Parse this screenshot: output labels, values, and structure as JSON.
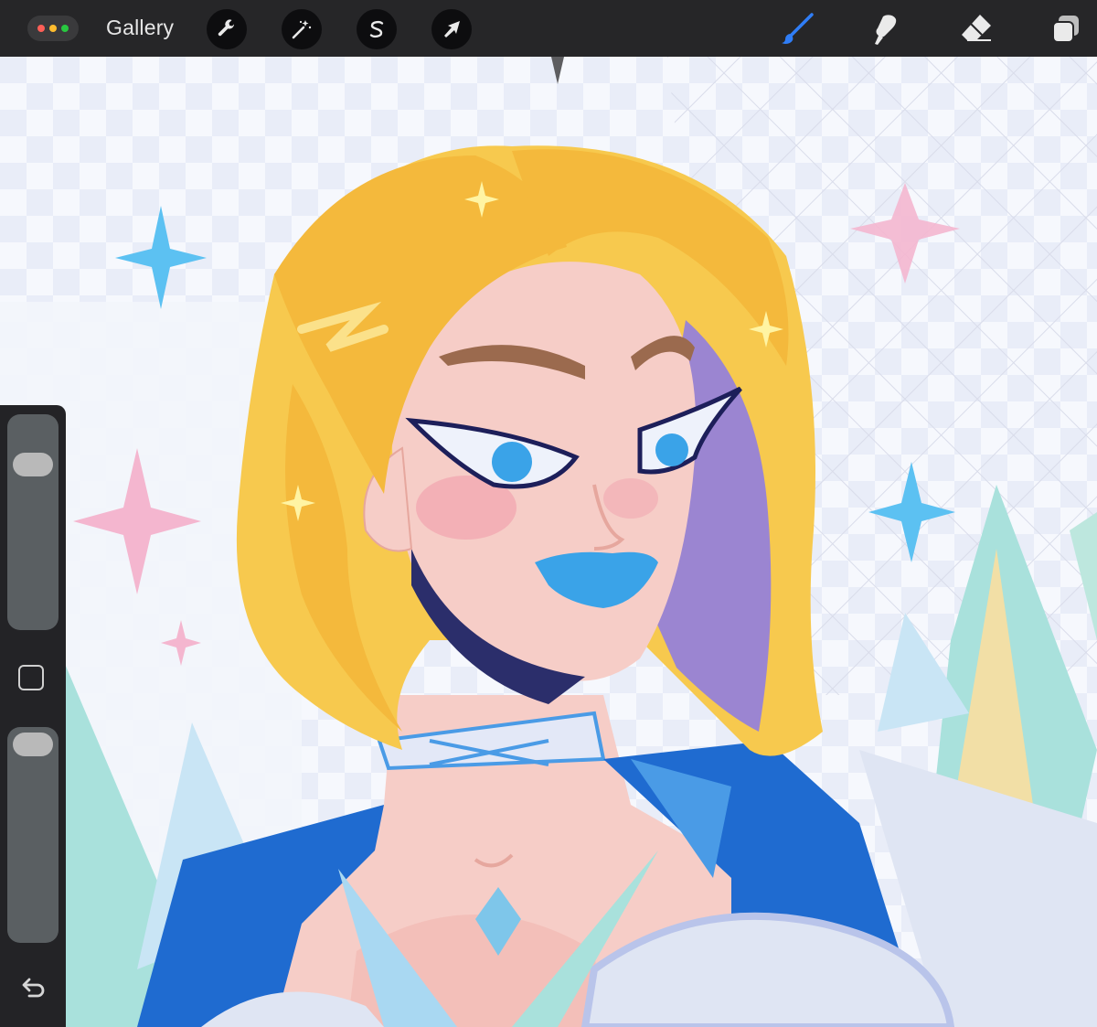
{
  "app": {
    "gallery_label": "Gallery"
  },
  "toolbar": {
    "left_tools": [
      {
        "name": "actions",
        "icon": "wrench-icon"
      },
      {
        "name": "adjustments",
        "icon": "magic-wand-icon"
      },
      {
        "name": "selection",
        "icon": "selection-s-icon"
      },
      {
        "name": "transform",
        "icon": "arrow-cursor-icon"
      }
    ],
    "right_tools": [
      {
        "name": "brush",
        "icon": "brush-icon",
        "active": true
      },
      {
        "name": "smudge",
        "icon": "smudge-finger-icon",
        "active": false
      },
      {
        "name": "eraser",
        "icon": "eraser-icon",
        "active": false
      },
      {
        "name": "layers",
        "icon": "layers-icon",
        "active": false
      }
    ],
    "active_color": "#2f7df6"
  },
  "sidebar": {
    "brush_size_icon": "brush-size-slider",
    "opacity_icon": "opacity-slider",
    "modify_icon": "square-icon",
    "undo_icon": "undo-arrow-icon"
  },
  "colors": {
    "hair": "#f7c94e",
    "skin": "#f6cdc7",
    "cape": "#1f6bd0",
    "lips": "#3aa3e8",
    "shadow": "#8b78c7",
    "sparkle_pink": "#f4b6cf",
    "sparkle_blue": "#5cc1f2"
  }
}
